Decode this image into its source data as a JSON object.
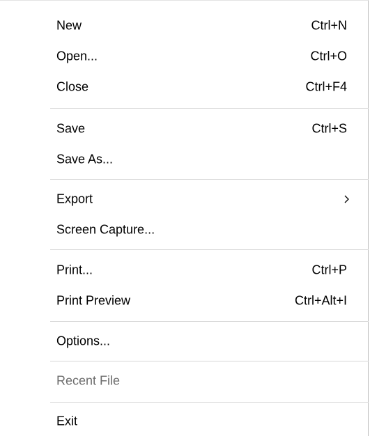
{
  "menu": {
    "items": {
      "new": {
        "label": "New",
        "shortcut": "Ctrl+N"
      },
      "open": {
        "label": "Open...",
        "shortcut": "Ctrl+O"
      },
      "close": {
        "label": "Close",
        "shortcut": "Ctrl+F4"
      },
      "save": {
        "label": "Save",
        "shortcut": "Ctrl+S"
      },
      "save_as": {
        "label": "Save As..."
      },
      "export": {
        "label": "Export"
      },
      "screen_capture": {
        "label": "Screen Capture..."
      },
      "print": {
        "label": "Print...",
        "shortcut": "Ctrl+P"
      },
      "print_preview": {
        "label": "Print Preview",
        "shortcut": "Ctrl+Alt+I"
      },
      "options": {
        "label": "Options..."
      },
      "recent_file": {
        "label": "Recent File",
        "disabled": true
      },
      "exit": {
        "label": "Exit"
      }
    },
    "icons": {
      "submenu": "chevron-right-icon"
    },
    "colors": {
      "text": "#000000",
      "disabled_text": "#6d6d6d",
      "separator": "#d7d7d7",
      "background": "#ffffff"
    }
  }
}
